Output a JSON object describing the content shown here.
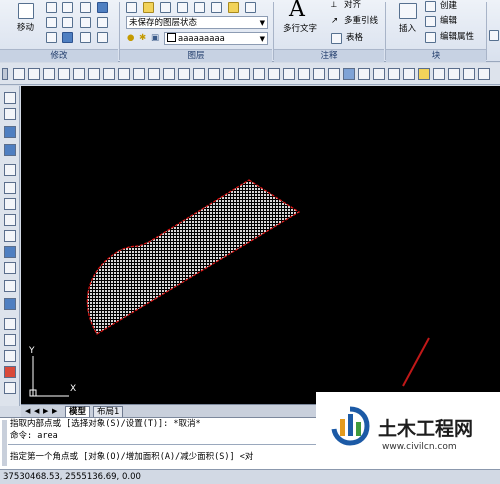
{
  "ribbon": {
    "panels": {
      "modify": "修改",
      "layers": "图层",
      "annotation": "注释",
      "block": "块"
    },
    "modify_move": "移动",
    "layer_state": "未保存的图层状态",
    "layer_name": "aaaaaaaaa",
    "multiline_text": "多行文字",
    "align": "对齐",
    "multileader": "多重引线",
    "table": "表格",
    "insert": "插入",
    "create": "创建",
    "edit": "编辑",
    "edit_attribute": "编辑属性"
  },
  "tabs": {
    "model": "模型",
    "layout1": "布局1"
  },
  "command": {
    "line1": "指取内部点或 [选择对象(S)/设置(T)]: *取消*",
    "line2": "命令: area",
    "line3": "指定第一个角点或 [对象(O)/增加面积(A)/减少面积(S)] <对"
  },
  "status": {
    "coords": "37530468.53, 2555136.69, 0.00"
  },
  "ucs": {
    "x_label": "X",
    "y_label": "Y"
  },
  "watermark": {
    "title": "土木工程网",
    "url": "www.civilcn.com"
  }
}
